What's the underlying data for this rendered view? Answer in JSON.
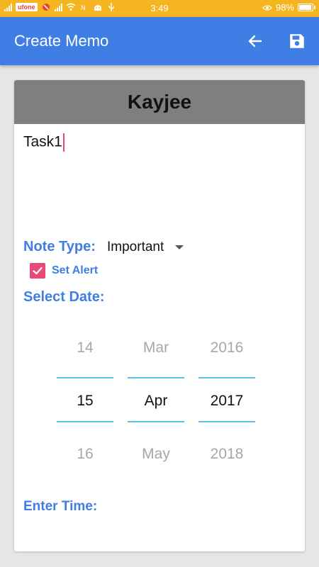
{
  "status_bar": {
    "carrier": "ufone",
    "time": "3:49",
    "battery": "98%"
  },
  "app_bar": {
    "title": "Create Memo",
    "back_icon": "arrow-left-icon",
    "save_icon": "save-icon"
  },
  "memo": {
    "header_name": "Kayjee",
    "text": "Task1"
  },
  "note_type": {
    "label": "Note Type:",
    "selected": "Important"
  },
  "alert": {
    "label": "Set Alert",
    "checked": true
  },
  "date_picker": {
    "label": "Select Date:",
    "day": {
      "prev": "14",
      "current": "15",
      "next": "16"
    },
    "month": {
      "prev": "Mar",
      "current": "Apr",
      "next": "May"
    },
    "year": {
      "prev": "2016",
      "current": "2017",
      "next": "2018"
    }
  },
  "time_picker": {
    "label": "Enter Time:"
  },
  "colors": {
    "status_bar": "#f4b520",
    "app_bar": "#3f7ee5",
    "accent_pink": "#e84a78",
    "picker_line": "#5bc0e8",
    "header_gray": "#7f7f7f"
  }
}
